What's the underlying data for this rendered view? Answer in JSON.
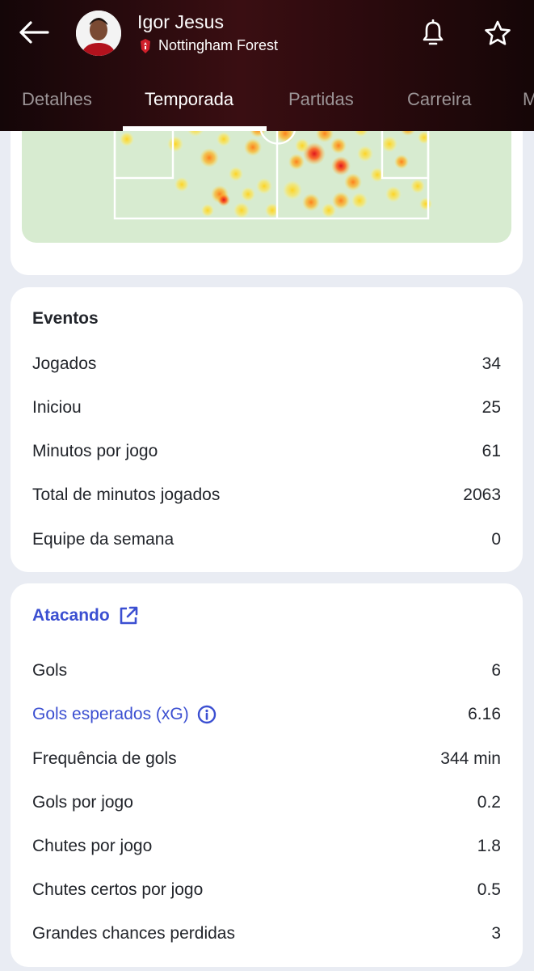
{
  "player": {
    "name": "Igor Jesus",
    "team": "Nottingham Forest"
  },
  "tabs": [
    {
      "label": "Detalhes"
    },
    {
      "label": "Temporada"
    },
    {
      "label": "Partidas"
    },
    {
      "label": "Carreira"
    },
    {
      "label": "M"
    }
  ],
  "active_tab": "Temporada",
  "eventos": {
    "title": "Eventos",
    "rows": [
      {
        "label": "Jogados",
        "value": "34"
      },
      {
        "label": "Iniciou",
        "value": "25"
      },
      {
        "label": "Minutos por jogo",
        "value": "61"
      },
      {
        "label": "Total de minutos jogados",
        "value": "2063"
      },
      {
        "label": "Equipe da semana",
        "value": "0"
      }
    ]
  },
  "atacando": {
    "title": "Atacando",
    "rows": [
      {
        "label": "Gols",
        "value": "6"
      },
      {
        "label": "Gols esperados (xG)",
        "value": "6.16"
      },
      {
        "label": "Frequência de gols",
        "value": "344 min"
      },
      {
        "label": "Gols por jogo",
        "value": "0.2"
      },
      {
        "label": "Chutes por jogo",
        "value": "1.8"
      },
      {
        "label": "Chutes certos por jogo",
        "value": "0.5"
      },
      {
        "label": "Grandes chances perdidas",
        "value": "3"
      }
    ]
  },
  "colors": {
    "header_bg": "#2a0a0d",
    "accent_link": "#3b4fd1",
    "pitch": "#d7ebd0"
  },
  "icons": {
    "back": "arrow-left-icon",
    "bell": "bell-icon",
    "star": "star-icon",
    "external": "external-link-icon",
    "info": "info-icon"
  }
}
